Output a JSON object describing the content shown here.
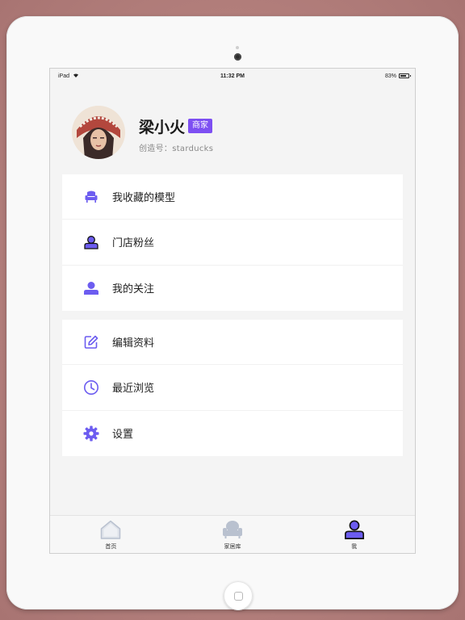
{
  "status_bar": {
    "device": "iPad",
    "time": "11:32 PM",
    "battery_text": "83%",
    "battery_level": 0.83
  },
  "profile": {
    "name": "梁小火",
    "badge": "商家",
    "creator_id": "创造号：starducks"
  },
  "menu_group_1": [
    {
      "label": "我收藏的模型",
      "icon": "armchair-icon"
    },
    {
      "label": "门店粉丝",
      "icon": "fan-user-icon"
    },
    {
      "label": "我的关注",
      "icon": "user-icon"
    }
  ],
  "menu_group_2": [
    {
      "label": "编辑资料",
      "icon": "edit-icon"
    },
    {
      "label": "最近浏览",
      "icon": "clock-icon"
    },
    {
      "label": "设置",
      "icon": "gear-icon"
    }
  ],
  "tab_bar": {
    "items": [
      {
        "label": "首页",
        "icon": "home-icon"
      },
      {
        "label": "家居库",
        "icon": "sofa-icon"
      },
      {
        "label": "我",
        "icon": "profile-icon"
      }
    ],
    "active_index": 2
  },
  "colors": {
    "accent": "#6c5cf0",
    "badge_bg": "#7d4ff2",
    "inactive_icon": "#b9c1cf"
  }
}
